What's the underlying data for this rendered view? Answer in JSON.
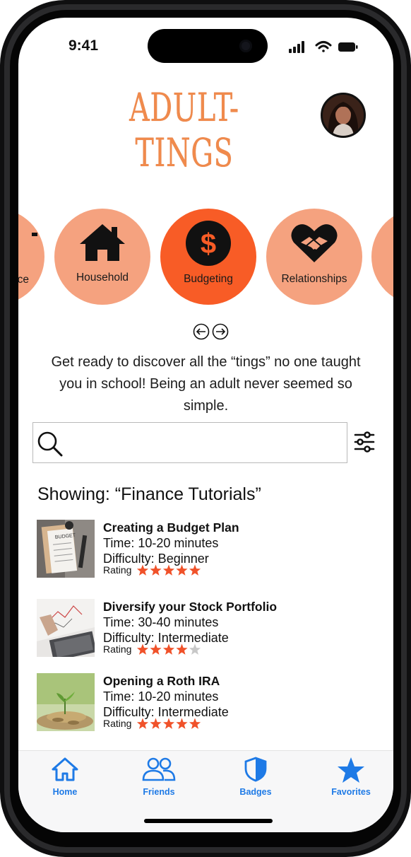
{
  "status_bar": {
    "time": "9:41"
  },
  "header": {
    "app_title": "ADULT-TINGS"
  },
  "categories": [
    {
      "label": "ce",
      "icon": "finance-icon",
      "state": "partial"
    },
    {
      "label": "Household",
      "icon": "house-icon",
      "state": "default"
    },
    {
      "label": "Budgeting",
      "icon": "dollar-icon",
      "state": "selected"
    },
    {
      "label": "Relationships",
      "icon": "heart-hands-icon",
      "state": "default"
    },
    {
      "label": "",
      "icon": "",
      "state": "partial"
    }
  ],
  "intro_text": "Get ready to discover all the “tings” no one taught you in school! Being an adult never seemed so simple.",
  "search": {
    "placeholder": "",
    "value": ""
  },
  "results": {
    "heading": "Showing: “Finance Tutorials”",
    "items": [
      {
        "title": "Creating a Budget Plan",
        "time": "Time: 10-20 minutes",
        "difficulty": "Difficulty: Beginner",
        "rating_label": "Rating",
        "rating": 5,
        "thumb_text": "BUDGET"
      },
      {
        "title": "Diversify your Stock Portfolio",
        "time": "Time: 30-40 minutes",
        "difficulty": "Difficulty: Intermediate",
        "rating_label": "Rating",
        "rating": 4
      },
      {
        "title": "Opening a Roth IRA",
        "time": "Time: 10-20 minutes",
        "difficulty": "Difficulty: Intermediate",
        "rating_label": "Rating",
        "rating": 5
      }
    ]
  },
  "tabbar": {
    "home": "Home",
    "friends": "Friends",
    "badges": "Badges",
    "favorites": "Favorites"
  },
  "colors": {
    "accent": "#f85c26",
    "category_bg": "#f5a27f",
    "title": "#f08a4c",
    "star": "#f0522a",
    "tab_blue": "#1e7ae6"
  }
}
